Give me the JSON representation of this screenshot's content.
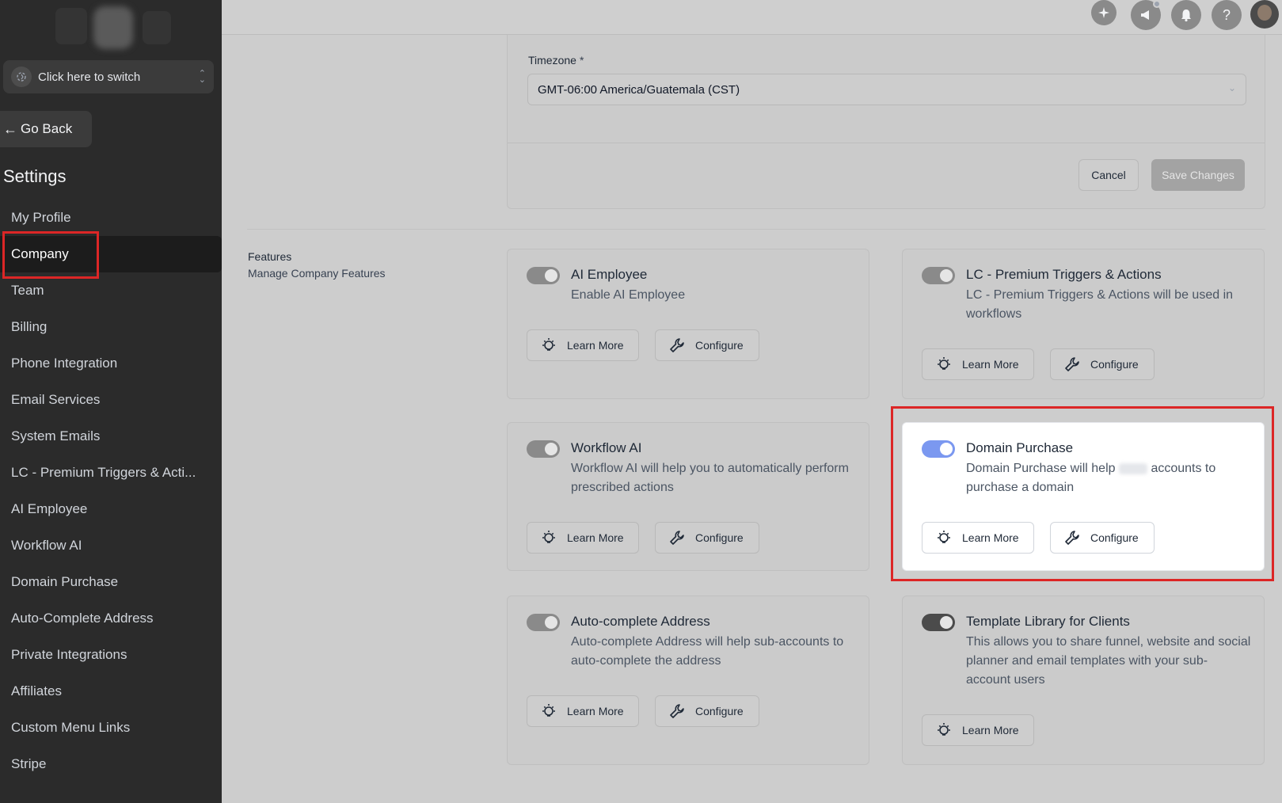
{
  "sidebar": {
    "switcher_label": "Click here to switch",
    "go_back_label": "Go Back",
    "settings_title": "Settings",
    "items": [
      {
        "label": "My Profile"
      },
      {
        "label": "Company"
      },
      {
        "label": "Team"
      },
      {
        "label": "Billing"
      },
      {
        "label": "Phone Integration"
      },
      {
        "label": "Email Services"
      },
      {
        "label": "System Emails"
      },
      {
        "label": "LC - Premium Triggers & Acti..."
      },
      {
        "label": "AI Employee"
      },
      {
        "label": "Workflow AI"
      },
      {
        "label": "Domain Purchase"
      },
      {
        "label": "Auto-Complete Address"
      },
      {
        "label": "Private Integrations"
      },
      {
        "label": "Affiliates"
      },
      {
        "label": "Custom Menu Links"
      },
      {
        "label": "Stripe"
      }
    ],
    "active_item": "Company"
  },
  "topbar": {
    "icons": [
      "ai-sparkle-icon",
      "megaphone-icon",
      "bell-icon",
      "help-icon",
      "user-avatar"
    ],
    "help_glyph": "?"
  },
  "timezone": {
    "label": "Timezone",
    "required_mark": "*",
    "value": "GMT-06:00 America/Guatemala (CST)",
    "cancel_label": "Cancel",
    "save_label": "Save Changes"
  },
  "features_section": {
    "title": "Features",
    "subtitle": "Manage Company Features",
    "learn_more_label": "Learn More",
    "configure_label": "Configure",
    "items": [
      {
        "title": "AI Employee",
        "description": "Enable AI Employee",
        "enabled": false
      },
      {
        "title": "LC - Premium Triggers & Actions",
        "description": "LC - Premium Triggers & Actions will be used in workflows",
        "enabled": false
      },
      {
        "title": "Workflow AI",
        "description": "Workflow AI will help you to automatically perform prescribed actions",
        "enabled": false
      },
      {
        "title": "Domain Purchase",
        "description_before": "Domain Purchase will help",
        "description_after": "accounts to purchase a domain",
        "enabled": true
      },
      {
        "title": "Auto-complete Address",
        "description": "Auto-complete Address will help sub-accounts to auto-complete the address",
        "enabled": false
      },
      {
        "title": "Template Library for Clients",
        "description": "This allows you to share funnel, website and social planner and email templates with your sub-account users",
        "enabled": true
      }
    ]
  },
  "colors": {
    "sidebar_bg": "#2b2b2b",
    "highlight_red": "#dc2626",
    "toggle_on": "#7b98f0"
  }
}
